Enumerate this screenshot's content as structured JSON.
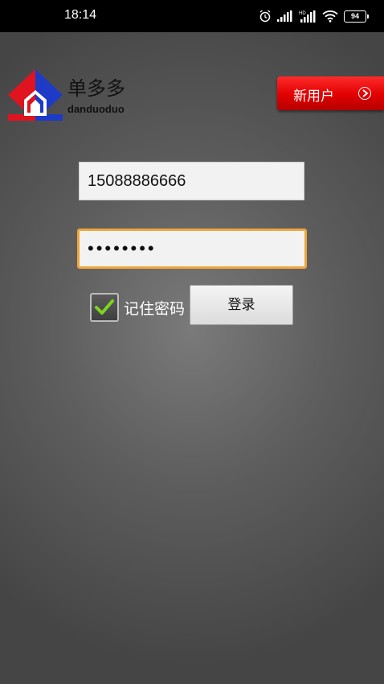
{
  "status_bar": {
    "time": "18:14",
    "battery": "94",
    "icons": [
      "alarm-icon",
      "signal-icon",
      "hd-signal-icon",
      "wifi-icon",
      "battery-icon"
    ]
  },
  "header": {
    "title": "单多多",
    "subtitle": "danduoduo",
    "new_user_label": "新用户"
  },
  "form": {
    "phone_value": "15088886666",
    "password_masked": "••••••••",
    "remember_label": "记住密码",
    "remember_checked": true,
    "login_label": "登录"
  },
  "colors": {
    "accent_red": "#e00000",
    "focus_orange": "#f0a63a",
    "logo_red": "#e0141e",
    "logo_blue": "#1e3bc8",
    "check_green": "#7ed321"
  }
}
